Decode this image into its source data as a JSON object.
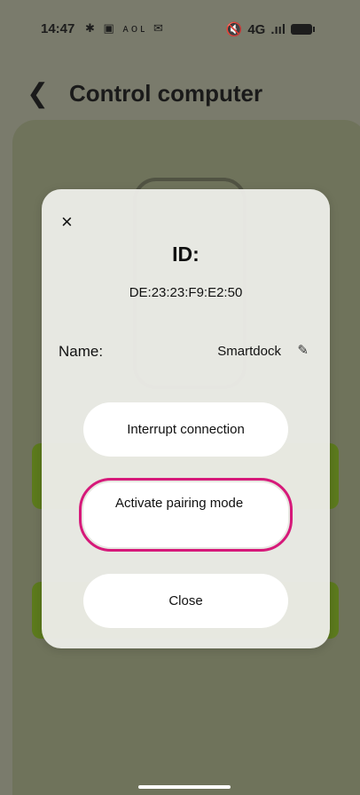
{
  "status_bar": {
    "time": "14:47",
    "notifications": "✱ ▣ ᴀᴏʟ ✉",
    "network": "4G",
    "signal": ".ııl"
  },
  "header": {
    "back_icon": "chevron-left-icon",
    "title": "Control computer"
  },
  "modal": {
    "close_symbol": "×",
    "id_label": "ID:",
    "id_value": "DE:23:23:F9:E2:50",
    "name_label": "Name:",
    "name_value": "Smartdock",
    "edit_symbol": "✎",
    "buttons": {
      "interrupt": "Interrupt connection",
      "pairing": "Activate pairing mode",
      "close": "Close"
    },
    "highlight_color": "#d6197a"
  }
}
